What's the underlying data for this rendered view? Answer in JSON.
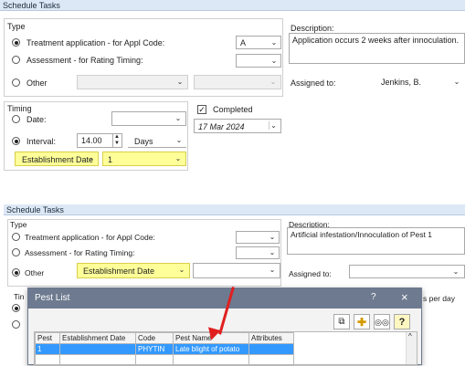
{
  "top_dialog": {
    "title": "Schedule Tasks",
    "type_label": "Type",
    "radio_treatment": "Treatment application - for Appl Code:",
    "appl_code_value": "A",
    "radio_assessment": "Assessment - for Rating Timing:",
    "radio_other": "Other",
    "description_label": "Description:",
    "description_text": "Application occurs 2 weeks after innoculation.",
    "assigned_label": "Assigned to:",
    "assigned_value": "Jenkins, B.",
    "timing_label": "Timing",
    "radio_date": "Date:",
    "radio_interval": "Interval:",
    "interval_value": "14.00",
    "interval_unit": "Days",
    "interval_from": "Establishment Date",
    "interval_pest": "1",
    "completed_label": "Completed",
    "completed_date": "17 Mar 2024"
  },
  "bottom_dialog": {
    "title": "Schedule Tasks",
    "type_label": "Type",
    "radio_treatment": "Treatment application - for Appl Code:",
    "radio_assessment": "Assessment - for Rating Timing:",
    "radio_other": "Other",
    "other_value": "Establishment Date",
    "description_label": "Description:",
    "description_text": "Artificial infestation/Innoculation of Pest 1",
    "assigned_label": "Assigned to:",
    "timing_label_partial": "Tin",
    "per_day_partial": "s per day"
  },
  "pest_list": {
    "title": "Pest List",
    "help_label": "?",
    "close_label": "×",
    "columns": [
      "Pest",
      "Establishment Date",
      "Code",
      "Pest Name",
      "Attributes"
    ],
    "rows": [
      {
        "pest": "1",
        "establishment_date": "",
        "code": "PHYTIN",
        "pest_name": "Late blight of potato",
        "attributes": ""
      }
    ]
  },
  "colors": {
    "highlight": "#ffff99",
    "selection": "#3399ff",
    "arrow": "#e02020",
    "titlebar": "#dce8f6"
  },
  "icons": [
    "copy-icon",
    "pest-cross-icon",
    "binoculars-icon",
    "help-icon",
    "close-icon",
    "chevron-down-icon"
  ]
}
